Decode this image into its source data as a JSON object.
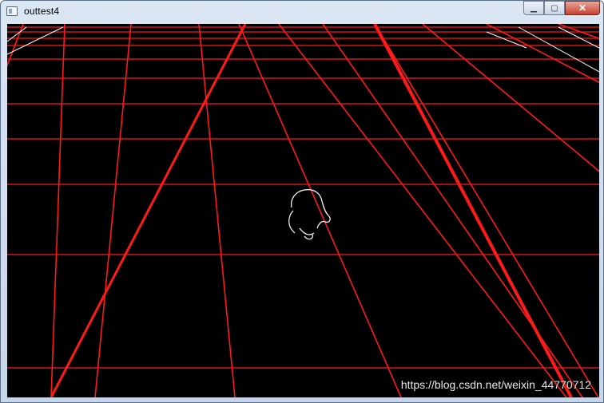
{
  "window": {
    "title": "outtest4",
    "controls": {
      "minimize": "▁",
      "maximize": "▢",
      "close": "✕"
    }
  },
  "canvas": {
    "background": "#000000",
    "grid_color": "#ff1a1a",
    "figure_color": "#ffffff"
  },
  "watermark": "https://blog.csdn.net/weixin_44770712"
}
